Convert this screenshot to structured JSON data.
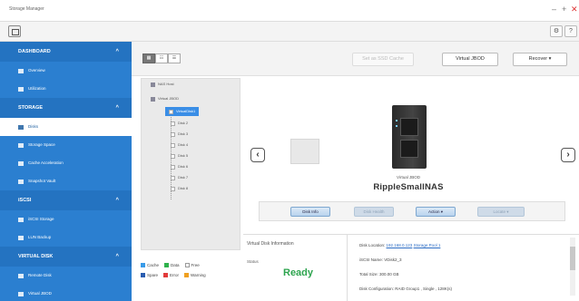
{
  "window": {
    "title": "Storage Manager",
    "controls": [
      "–",
      "+",
      "✕"
    ]
  },
  "toolbar": {
    "right_icons": [
      "gear-icon",
      "help-icon"
    ]
  },
  "sidebar": {
    "sections": [
      {
        "heading": "DASHBOARD",
        "items": [
          {
            "label": "Overview"
          },
          {
            "label": "Utilization"
          }
        ]
      },
      {
        "heading": "STORAGE",
        "items": [
          {
            "label": "Disks",
            "active": true
          },
          {
            "label": "Storage Space"
          },
          {
            "label": "Cache Acceleration"
          },
          {
            "label": "Snapshot Vault"
          }
        ]
      },
      {
        "heading": "iSCSI",
        "items": [
          {
            "label": "iSCSI Storage"
          },
          {
            "label": "LUN Backup"
          }
        ]
      },
      {
        "heading": "VIRTUAL DISK",
        "items": [
          {
            "label": "Remote Disk"
          },
          {
            "label": "Virtual JBOD"
          }
        ]
      }
    ]
  },
  "topbar": {
    "view_buttons": [
      "▦",
      "☷",
      "☰"
    ],
    "set_ssd_cache": "Set as SSD Cache",
    "virtual_jbod": "Virtual JBOD",
    "recover": "Recover ▾"
  },
  "tree": {
    "nodes": [
      {
        "label": "NAS Host",
        "level": 0
      },
      {
        "label": "Virtual JBOD",
        "level": 0
      },
      {
        "label": "VirtualDisk1",
        "level": 1,
        "selected": true
      },
      {
        "label": "Disk 2",
        "level": 1
      },
      {
        "label": "Disk 3",
        "level": 1
      },
      {
        "label": "Disk 4",
        "level": 1
      },
      {
        "label": "Disk 5",
        "level": 1
      },
      {
        "label": "Disk 6",
        "level": 1
      },
      {
        "label": "Disk 7",
        "level": 1
      },
      {
        "label": "Disk 8",
        "level": 1
      }
    ]
  },
  "legend": {
    "rows": [
      [
        {
          "label": "Cache",
          "color": "#3a9be8"
        },
        {
          "label": "Data",
          "color": "#2fb24c"
        },
        {
          "label": "Free",
          "color": "#ffffff"
        }
      ],
      [
        {
          "label": "Spare",
          "color": "#2a5db0"
        },
        {
          "label": "Error",
          "color": "#e23b3b"
        },
        {
          "label": "Warning",
          "color": "#f0a020"
        }
      ]
    ]
  },
  "device": {
    "subtitle": "Virtual JBOD",
    "name": "RippleSmallNAS"
  },
  "actions": {
    "disk_info": "Disk Info",
    "disk_health": "Disk Health",
    "action": "Action ▾",
    "locate": "Locate ▾"
  },
  "info": {
    "header": "Virtual Disk Information",
    "status_label": "Status",
    "status_value": "Ready",
    "disk_location_label": "Disk Location:",
    "disk_location_ip": "192.168.0.123",
    "disk_location_pool": "Storage Pool 1",
    "iscsi_name": "iSCSI Name: VDisk2_3",
    "total_size": "Total Size: 300.00 GB",
    "disk_config": "Disk Configuration: RAID Group1 , Single , 128K(s)"
  },
  "colors": {
    "sidebar": "#2b7fd0",
    "accent": "#3a8ee6",
    "ready": "#2da44e"
  }
}
